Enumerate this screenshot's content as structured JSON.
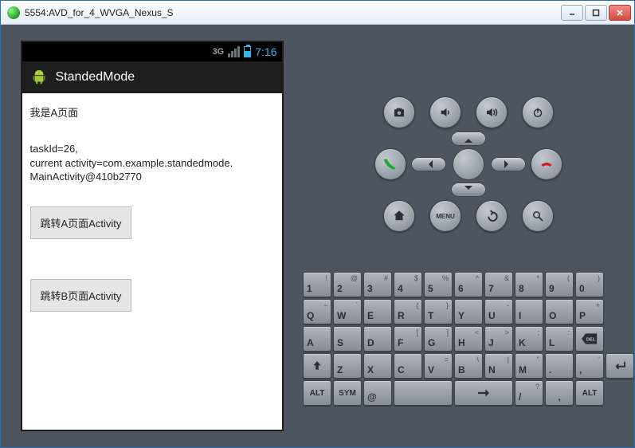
{
  "window": {
    "title": "5554:AVD_for_4_WVGA_Nexus_S"
  },
  "status_bar": {
    "network": "3G",
    "time": "7:16"
  },
  "action_bar": {
    "title": "StandedMode"
  },
  "activity": {
    "page_label": "我是A页面",
    "info_line1": "taskId=26,",
    "info_line2": "current activity=com.example.standedmode.",
    "info_line3": "MainActivity@410b2770",
    "btn_a": "跳转A页面Activity",
    "btn_b": "跳转B页面Activity"
  },
  "hw_buttons": {
    "menu_label": "MENU"
  },
  "keyboard": {
    "row1": [
      {
        "main": "1",
        "sup": "!"
      },
      {
        "main": "2",
        "sup": "@"
      },
      {
        "main": "3",
        "sup": "#"
      },
      {
        "main": "4",
        "sup": "$"
      },
      {
        "main": "5",
        "sup": "%"
      },
      {
        "main": "6",
        "sup": "^"
      },
      {
        "main": "7",
        "sup": "&"
      },
      {
        "main": "8",
        "sup": "*"
      },
      {
        "main": "9",
        "sup": "("
      },
      {
        "main": "0",
        "sup": ")"
      }
    ],
    "row2": [
      {
        "main": "Q",
        "sup": "~"
      },
      {
        "main": "W",
        "sup": "`"
      },
      {
        "main": "E",
        "sup": ""
      },
      {
        "main": "R",
        "sup": "{"
      },
      {
        "main": "T",
        "sup": "}"
      },
      {
        "main": "Y",
        "sup": ""
      },
      {
        "main": "U",
        "sup": "-"
      },
      {
        "main": "I",
        "sup": ""
      },
      {
        "main": "O",
        "sup": ""
      },
      {
        "main": "P",
        "sup": "+"
      }
    ],
    "row3": [
      {
        "main": "A",
        "sup": ""
      },
      {
        "main": "S",
        "sup": ""
      },
      {
        "main": "D",
        "sup": ""
      },
      {
        "main": "F",
        "sup": "["
      },
      {
        "main": "G",
        "sup": "]"
      },
      {
        "main": "H",
        "sup": "<"
      },
      {
        "main": "J",
        "sup": ">"
      },
      {
        "main": "K",
        "sup": ";"
      },
      {
        "main": "L",
        "sup": ":"
      }
    ],
    "row4": [
      {
        "main": "Z",
        "sup": ""
      },
      {
        "main": "X",
        "sup": ""
      },
      {
        "main": "C",
        "sup": ""
      },
      {
        "main": "V",
        "sup": "="
      },
      {
        "main": "B",
        "sup": "\\"
      },
      {
        "main": "N",
        "sup": "|"
      },
      {
        "main": "M",
        "sup": "\""
      },
      {
        "main": ".",
        "sup": ""
      },
      {
        "main": ",",
        "sup": "'"
      }
    ],
    "row5": {
      "alt": "ALT",
      "sym": "SYM",
      "at": "@",
      "slash": "/",
      "qmark": "?"
    }
  }
}
